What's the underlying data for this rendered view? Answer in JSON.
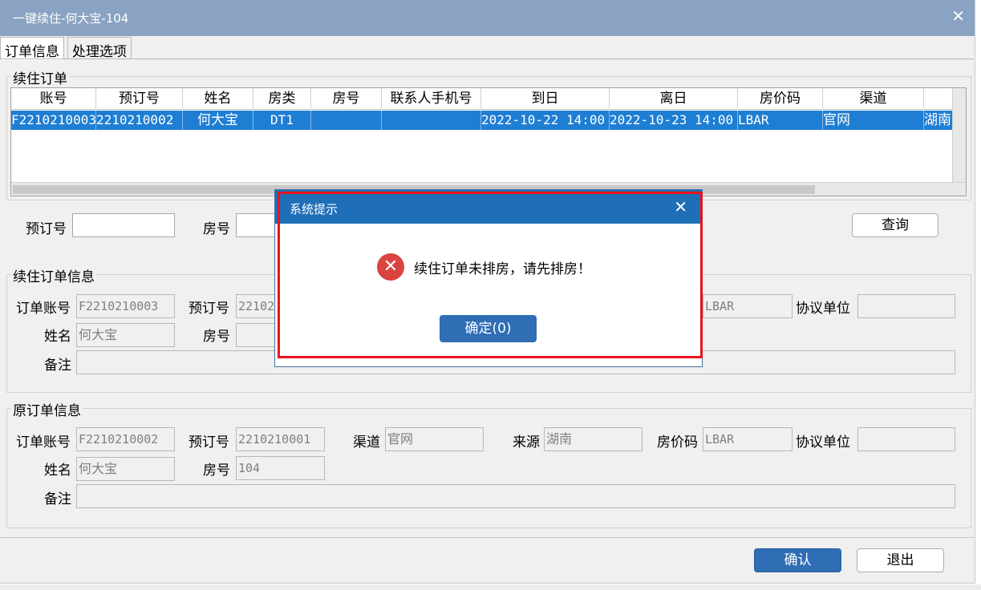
{
  "window": {
    "title": "一键续住-何大宝-104",
    "close_glyph": "✕"
  },
  "tabs": [
    {
      "label": "订单信息",
      "active": true
    },
    {
      "label": "处理选项",
      "active": false
    }
  ],
  "renewal_orders": {
    "group_title": "续住订单",
    "columns": [
      "账号",
      "预订号",
      "姓名",
      "房类",
      "房号",
      "联系人手机号",
      "到日",
      "离日",
      "房价码",
      "渠道"
    ],
    "rows": [
      [
        "F2210210003",
        "2210210002",
        "何大宝",
        "DT1",
        "",
        "",
        "2022-10-22 14:00",
        "2022-10-23 14:00",
        "LBAR",
        "官网",
        "湖南"
      ]
    ]
  },
  "search": {
    "booking_no_label": "预订号",
    "booking_no_value": "",
    "room_no_label": "房号",
    "room_no_value": "",
    "query_button": "查询"
  },
  "renewal_info": {
    "group_title": "续住订单信息",
    "order_account_label": "订单账号",
    "order_account_value": "F2210210003",
    "booking_no_label": "预订号",
    "booking_no_value": "22102",
    "rate_code_value": "LBAR",
    "agreement_unit_label": "协议单位",
    "agreement_unit_value": "",
    "name_label": "姓名",
    "name_value": "何大宝",
    "room_no_label": "房号",
    "room_no_value": "",
    "remark_label": "备注",
    "remark_value": ""
  },
  "original_info": {
    "group_title": "原订单信息",
    "order_account_label": "订单账号",
    "order_account_value": "F2210210002",
    "booking_no_label": "预订号",
    "booking_no_value": "2210210001",
    "channel_label": "渠道",
    "channel_value": "官网",
    "source_label": "来源",
    "source_value": "湖南",
    "rate_code_label": "房价码",
    "rate_code_value": "LBAR",
    "agreement_unit_label": "协议单位",
    "agreement_unit_value": "",
    "name_label": "姓名",
    "name_value": "何大宝",
    "room_no_label": "房号",
    "room_no_value": "104",
    "remark_label": "备注",
    "remark_value": ""
  },
  "footer": {
    "confirm_button": "确认",
    "exit_button": "退出"
  },
  "dialog": {
    "title": "系统提示",
    "close_glyph": "✕",
    "icon": "error-icon",
    "icon_glyph": "✕",
    "message": "续住订单未排房，请先排房！",
    "ok_button": "确定(0)"
  },
  "colors": {
    "titlebar": "#8aa3c2",
    "selection": "#1e7ed4",
    "dialog_title": "#1f6fb8",
    "primary_button": "#2f6db5",
    "highlight_border": "#e8141c",
    "error_icon": "#d9443e"
  }
}
